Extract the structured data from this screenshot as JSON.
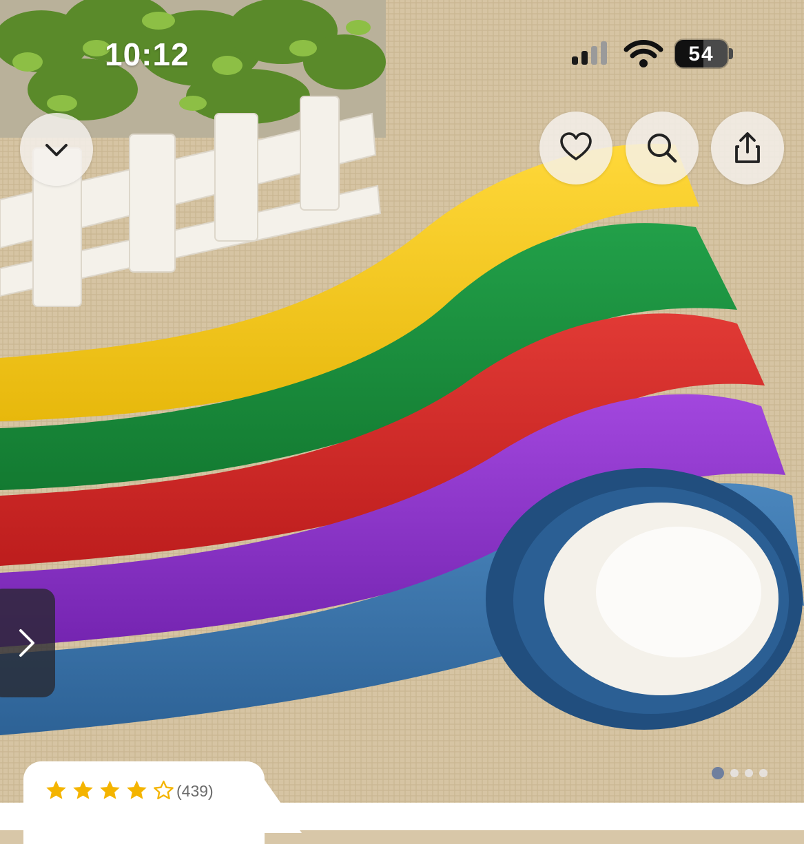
{
  "status_bar": {
    "time": "10:12",
    "battery_level": "54",
    "icons": [
      "signal-icon",
      "wifi-icon",
      "battery-icon"
    ]
  },
  "top_actions": {
    "collapse_icon": "chevron-down-icon",
    "favorite_icon": "heart-icon",
    "search_icon": "search-icon",
    "share_icon": "share-icon"
  },
  "gallery": {
    "next_icon": "chevron-right-icon",
    "total_images": 4,
    "current_index": 1,
    "ribbon_colors": [
      "#f3c31b",
      "#1a8a3a",
      "#d52727",
      "#8a2ec4",
      "#336fa6"
    ]
  },
  "rating": {
    "stars_filled": 4,
    "stars_total": 5,
    "count_label": "(439)",
    "star_color": "#f4b400"
  }
}
